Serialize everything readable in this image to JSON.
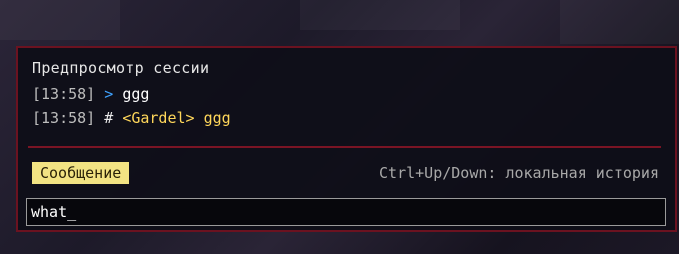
{
  "preview": {
    "title": "Предпросмотр сессии",
    "lines": [
      {
        "timestamp": "[13:58]",
        "marker": ">",
        "message": "ggg"
      },
      {
        "timestamp": "[13:58]",
        "marker": "#",
        "sender": "<Gardel>",
        "message": "ggg"
      }
    ]
  },
  "compose": {
    "badge_label": "Сообщение",
    "hint": "Ctrl+Up/Down: локальная история",
    "input_value": "what_"
  },
  "colors": {
    "accent_border": "#6b1220",
    "badge_bg": "#f2e383",
    "arrow": "#3ea2ff",
    "name": "#ffd75a"
  }
}
